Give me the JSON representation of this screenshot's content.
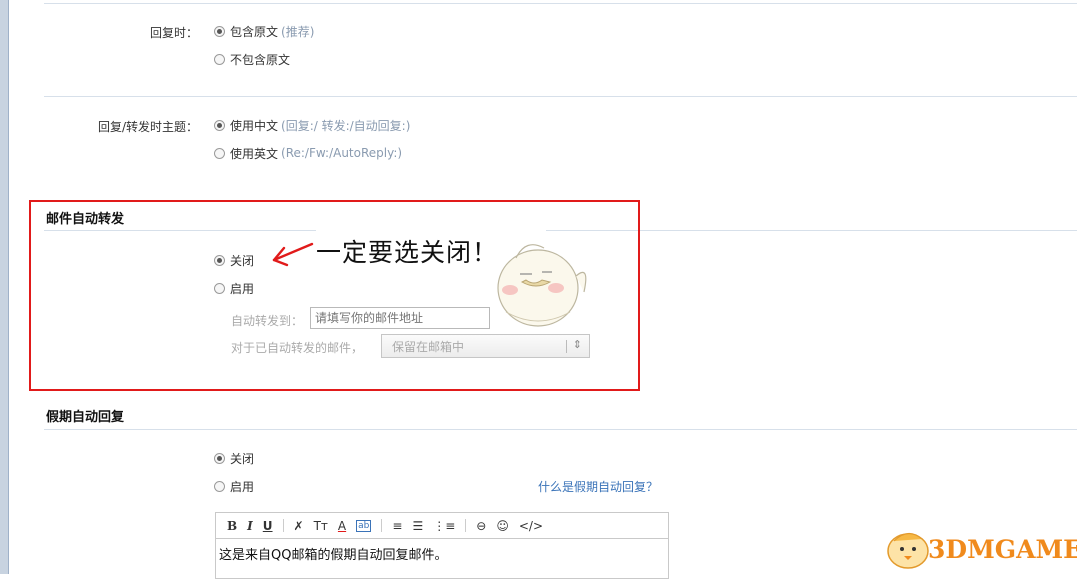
{
  "reply": {
    "label": "回复时：",
    "opt1": "包含原文",
    "opt1_hint": "(推荐)",
    "opt2": "不包含原文"
  },
  "subject": {
    "label": "回复/转发时主题：",
    "opt1": "使用中文",
    "opt1_hint": "(回复:/ 转发:/自动回复:)",
    "opt2": "使用英文",
    "opt2_hint": "(Re:/Fw:/AutoReply:)"
  },
  "forward": {
    "title": "邮件自动转发",
    "off": "关闭",
    "on": "启用",
    "to_label": "自动转发到：",
    "to_placeholder": "请填写你的邮件地址",
    "after_label": "对于已自动转发的邮件，",
    "after_value": "保留在邮箱中",
    "annotation": "一定要选关闭！"
  },
  "vacation": {
    "title": "假期自动回复",
    "off": "关闭",
    "on": "启用",
    "help_link": "什么是假期自动回复？",
    "editor_text": "这是来自QQ邮箱的假期自动回复邮件。"
  },
  "watermark": "3DMGAME",
  "colors": {
    "annotation_red": "#e11a1a",
    "link_blue": "#3a73b8",
    "watermark_orange": "#f08a1c"
  }
}
